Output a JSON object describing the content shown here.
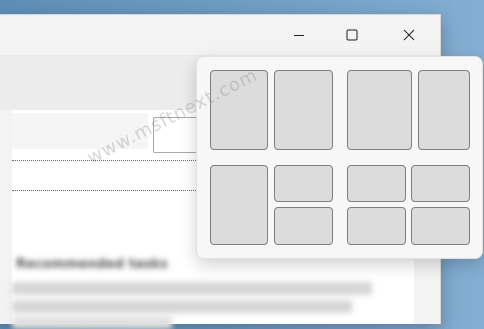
{
  "window": {
    "controls": {
      "minimize_icon": "minimize-icon",
      "maximize_icon": "maximize-icon",
      "close_icon": "close-icon"
    },
    "content": {
      "blurred_heading": "Recommended tasks"
    }
  },
  "snap_layouts": {
    "layouts": [
      {
        "name": "two-columns-even",
        "zones": 2
      },
      {
        "name": "two-columns-wide-left",
        "zones": 2
      },
      {
        "name": "one-left-two-right",
        "zones": 3
      },
      {
        "name": "four-quadrants",
        "zones": 4
      }
    ]
  },
  "watermark": "www.msftnext.com",
  "colors": {
    "desktop": "#6d9ac0",
    "window_bg": "#f3f3f3",
    "flyout_bg": "#f7f7f7",
    "zone_fill": "#dcdcdc",
    "zone_border": "#7f7f7f"
  }
}
